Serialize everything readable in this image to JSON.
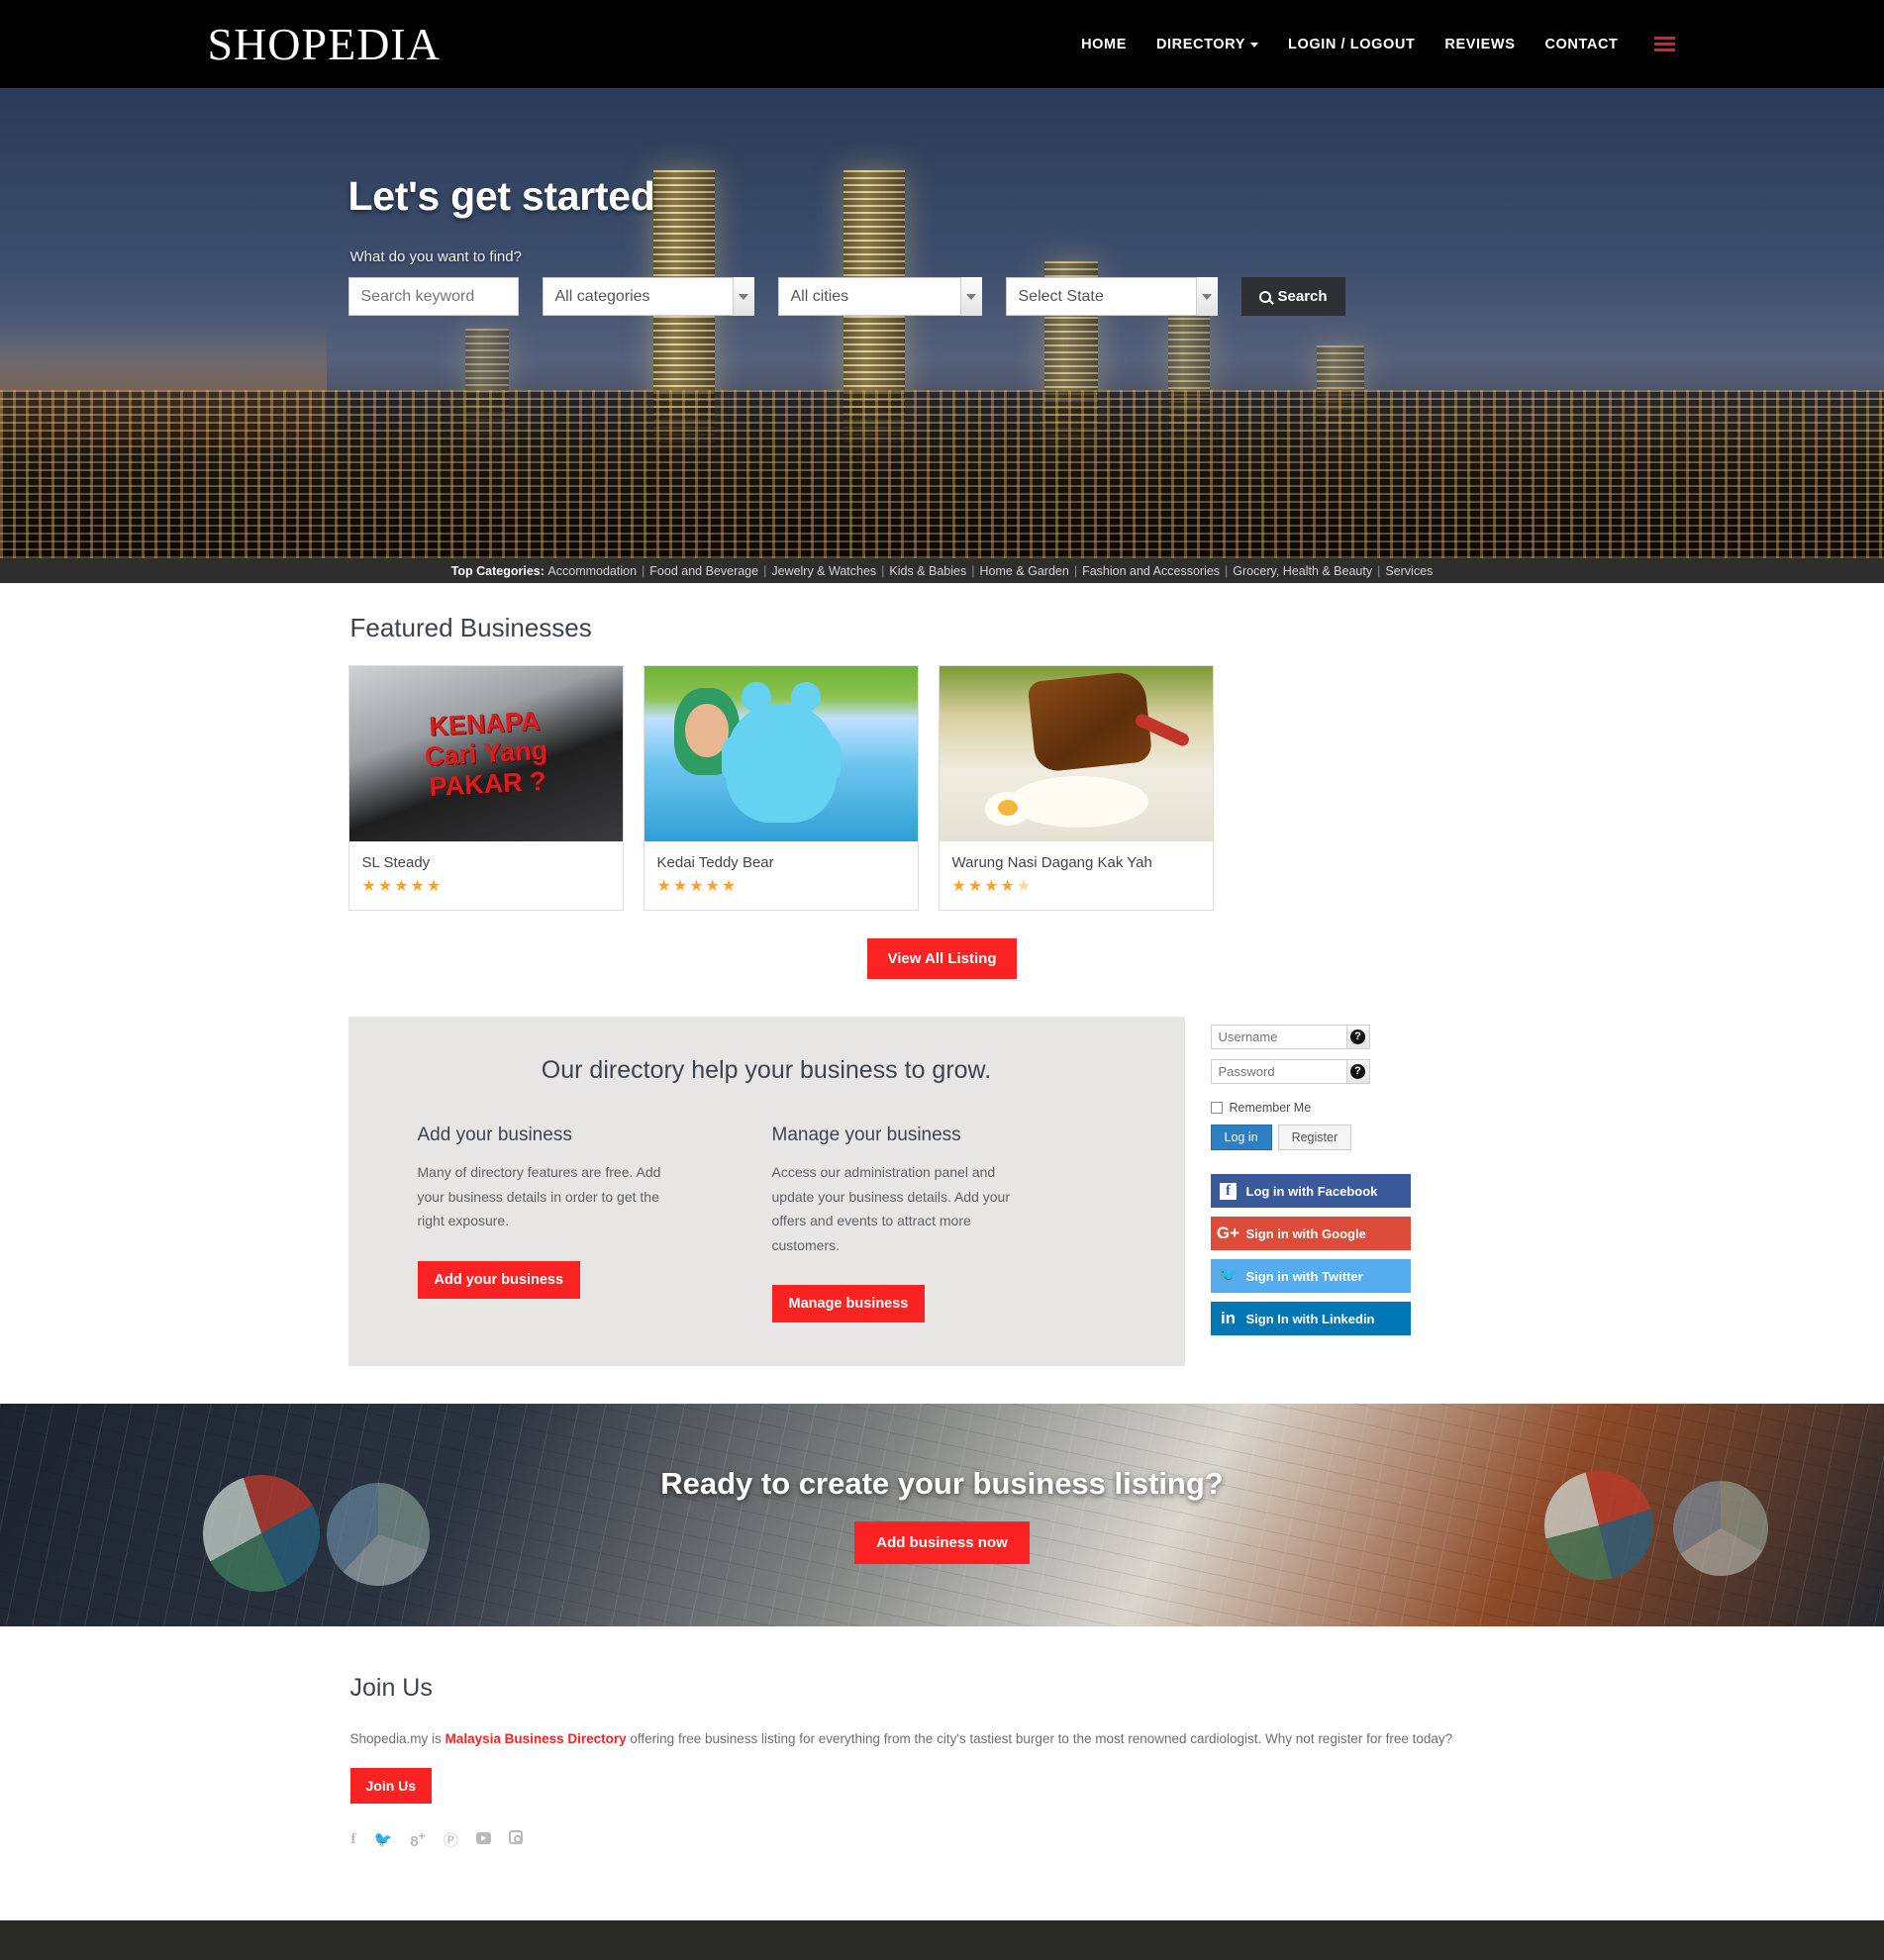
{
  "header": {
    "logo_main": "S",
    "logo_text": "HOPEDI",
    "logo_end": "A",
    "logo_full": "SHOPEDIA",
    "nav": [
      {
        "label": "HOME",
        "icon": ""
      },
      {
        "label": "DIRECTORY",
        "icon": "chevron-down-icon"
      },
      {
        "label": "LOGIN / LOGOUT",
        "icon": ""
      },
      {
        "label": "REVIEWS",
        "icon": ""
      },
      {
        "label": "CONTACT",
        "icon": ""
      }
    ],
    "menu_icon": "hamburger-icon"
  },
  "hero": {
    "title": "Let's get started",
    "subtitle": "What do you want to find?",
    "search": {
      "keyword_placeholder": "Search keyword",
      "category_value": "All categories",
      "city_value": "All cities",
      "state_value": "Select State",
      "button_label": "Search",
      "button_icon": "search-icon"
    }
  },
  "top_categories": {
    "label": "Top Categories:",
    "items": [
      "Accommodation",
      "Food and Beverage",
      "Jewelry & Watches",
      "Kids & Babies",
      "Home & Garden",
      "Fashion and Accessories",
      "Grocery, Health & Beauty",
      "Services"
    ]
  },
  "featured": {
    "title": "Featured Businesses",
    "cards": [
      {
        "name": "SL Steady",
        "rating": 5,
        "image_text_1": "KENAPA",
        "image_text_2": "Cari Yang",
        "image_text_3": "PAKAR ?"
      },
      {
        "name": "Kedai Teddy Bear",
        "rating": 5
      },
      {
        "name": "Warung Nasi Dagang Kak Yah",
        "rating": 4.5
      }
    ],
    "view_all_label": "View All Listing"
  },
  "grow": {
    "title": "Our directory help your business to grow.",
    "columns": [
      {
        "heading": "Add your business",
        "body": "Many of directory features are free. Add your business details in order to get the right exposure.",
        "button": "Add your business"
      },
      {
        "heading": "Manage your business",
        "body": "Access our administration panel and update your business details. Add your offers and events to attract more customers.",
        "button": "Manage business"
      }
    ]
  },
  "login": {
    "username_placeholder": "Username",
    "password_placeholder": "Password",
    "help_icon": "question-mark-icon",
    "remember_label": "Remember Me",
    "login_button": "Log in",
    "register_button": "Register",
    "social": [
      {
        "label": "Log in with Facebook",
        "icon": "facebook-icon",
        "color": "#3b5998"
      },
      {
        "label": "Sign in with Google",
        "icon": "google-plus-icon",
        "color": "#dd4b39"
      },
      {
        "label": "Sign in with Twitter",
        "icon": "twitter-icon",
        "color": "#55acee"
      },
      {
        "label": "Sign In with Linkedin",
        "icon": "linkedin-icon",
        "color": "#0077b5"
      }
    ]
  },
  "cta": {
    "title": "Ready to create your business listing?",
    "button": "Add business now"
  },
  "join": {
    "title": "Join Us",
    "text_before": "Shopedia.my is ",
    "highlight": "Malaysia Business Directory",
    "text_after": " offering free business listing for everything from the city's tastiest burger to the most renowned cardiologist. Why not register for free today?",
    "button": "Join Us",
    "social_icons": [
      "facebook-icon",
      "twitter-icon",
      "google-plus-icon",
      "pinterest-icon",
      "youtube-icon",
      "instagram-icon"
    ]
  },
  "colors": {
    "accent_red": "#fa2222",
    "header_black": "#000000",
    "topcats_bar": "#2e2e2e",
    "panel_gray": "#e8e6e4",
    "footer_dark": "#292b24",
    "star_gold": "#f5a623"
  }
}
